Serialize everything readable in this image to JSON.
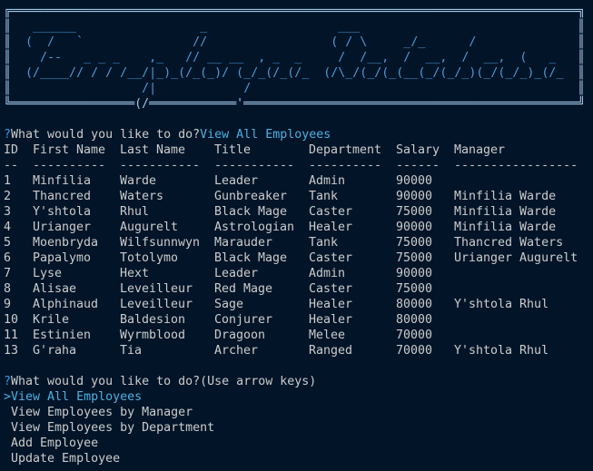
{
  "banner": {
    "lines": [
      "   ______                 _                  ___",
      "  (  /   `               //                 ( / \\     _/_      /",
      "    /--   _ _ _    ,_   // __ __  , _  _     /  /__,  /  __,  /  __,  (   _",
      "  (/____// / / /__/|_)_(/_(_)/ (_/_(/_(/_  (/\\_/(_/(_(__(_/(_/_)(_/(_/_)_(/_",
      "                  /|            /"
    ],
    "bottom_border": "╚═════════════════(/════════════'══════════════════════════════════════════════╝"
  },
  "prompt1": {
    "mark": "?",
    "question": "What would you like to do?",
    "answer": "View All Employees"
  },
  "table": {
    "headers": [
      "ID",
      "First Name",
      "Last Name",
      "Title",
      "Department",
      "Salary",
      "Manager"
    ],
    "dashes": [
      "--",
      "----------",
      "-----------",
      "-----------",
      "----------",
      "------",
      "-----------------"
    ],
    "rows": [
      [
        "1",
        "Minfilia",
        "Warde",
        "Leader",
        "Admin",
        "90000",
        ""
      ],
      [
        "2",
        "Thancred",
        "Waters",
        "Gunbreaker",
        "Tank",
        "90000",
        "Minfilia Warde"
      ],
      [
        "3",
        "Y'shtola",
        "Rhul",
        "Black Mage",
        "Caster",
        "75000",
        "Minfilia Warde"
      ],
      [
        "4",
        "Urianger",
        "Augurelt",
        "Astrologian",
        "Healer",
        "90000",
        "Minfilia Warde"
      ],
      [
        "5",
        "Moenbryda",
        "Wilfsunnwyn",
        "Marauder",
        "Tank",
        "75000",
        "Thancred Waters"
      ],
      [
        "6",
        "Papalymo",
        "Totolymo",
        "Black Mage",
        "Caster",
        "75000",
        "Urianger Augurelt"
      ],
      [
        "7",
        "Lyse",
        "Hext",
        "Leader",
        "Admin",
        "90000",
        ""
      ],
      [
        "8",
        "Alisae",
        "Leveilleur",
        "Red Mage",
        "Caster",
        "75000",
        ""
      ],
      [
        "9",
        "Alphinaud",
        "Leveilleur",
        "Sage",
        "Healer",
        "80000",
        "Y'shtola Rhul"
      ],
      [
        "10",
        "Krile",
        "Baldesion",
        "Conjurer",
        "Healer",
        "80000",
        ""
      ],
      [
        "11",
        "Estinien",
        "Wyrmblood",
        "Dragoon",
        "Melee",
        "70000",
        ""
      ],
      [
        "13",
        "G'raha",
        "Tia",
        "Archer",
        "Ranged",
        "70000",
        "Y'shtola Rhul"
      ]
    ]
  },
  "prompt2": {
    "mark": "?",
    "question": "What would you like to do?",
    "hint": "(Use arrow keys)"
  },
  "menu": {
    "pointer": ">",
    "selected_index": 0,
    "options": [
      "View All Employees",
      "View Employees by Manager",
      "View Employees by Department",
      "Add Employee",
      "Update Employee"
    ]
  },
  "colors": {
    "background": "#011428",
    "accent": "#3a96dd",
    "banner": "#4f9ad6",
    "text": "#cccccc"
  }
}
